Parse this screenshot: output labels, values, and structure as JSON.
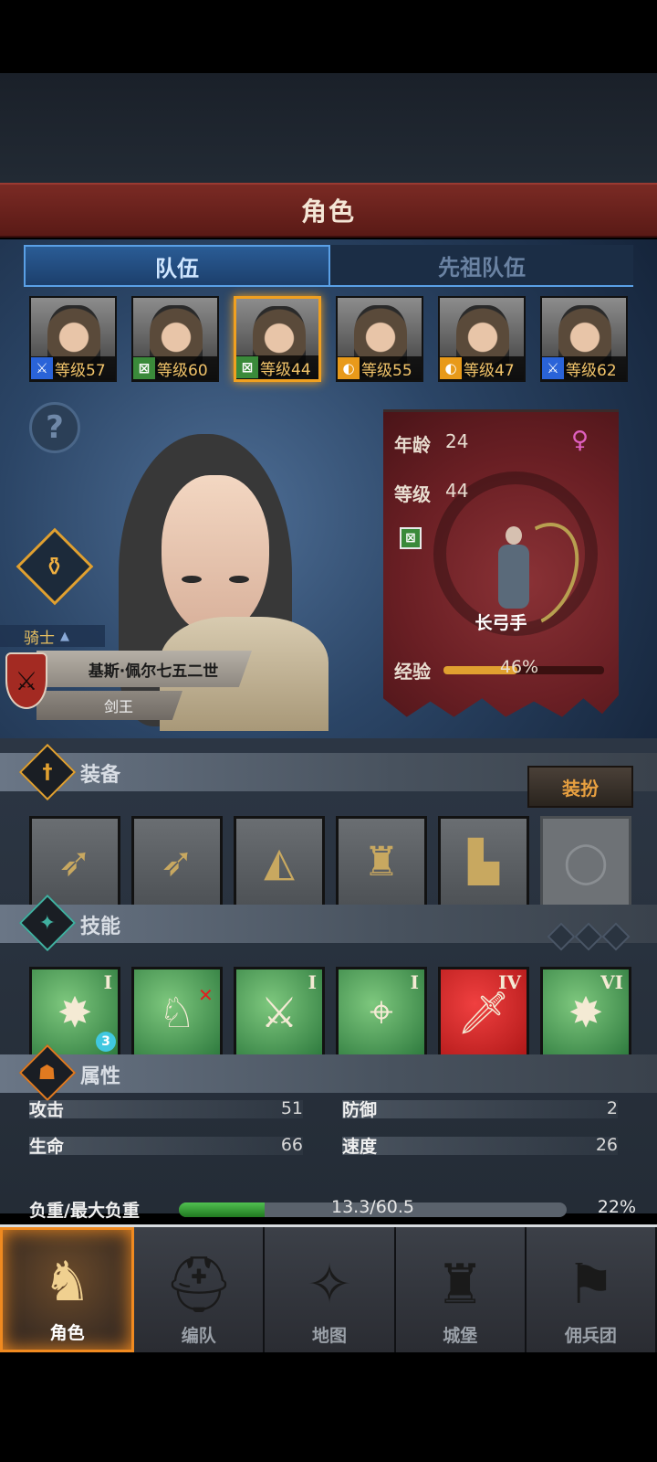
{
  "header": {
    "title": "角色"
  },
  "tabs": [
    {
      "label": "队伍",
      "active": true
    },
    {
      "label": "先祖队伍",
      "active": false
    }
  ],
  "roster": [
    {
      "class_icon": "sword-icon",
      "class_color": "#2a63d8",
      "level_text": "等级57",
      "selected": false
    },
    {
      "class_icon": "bow-icon",
      "class_color": "#3a8a3a",
      "level_text": "等级60",
      "selected": false
    },
    {
      "class_icon": "bow-icon",
      "class_color": "#3a8a3a",
      "level_text": "等级44",
      "selected": true
    },
    {
      "class_icon": "shield-icon",
      "class_color": "#e89a1a",
      "level_text": "等级55",
      "selected": false
    },
    {
      "class_icon": "shield-icon",
      "class_color": "#e89a1a",
      "level_text": "等级47",
      "selected": false
    },
    {
      "class_icon": "sword-icon",
      "class_color": "#2a63d8",
      "level_text": "等级62",
      "selected": false
    }
  ],
  "hero": {
    "rank": "骑士",
    "name": "基斯·佩尔七五二世",
    "title": "剑王"
  },
  "info": {
    "age_label": "年龄",
    "age": "24",
    "level_label": "等级",
    "level": "44",
    "gender": "female",
    "class_name": "长弓手",
    "exp_label": "经验",
    "exp_percent": "46%",
    "exp_fraction": 0.46
  },
  "equipment": {
    "title": "装备",
    "dress_button": "装扮",
    "slots": [
      {
        "icon": "longbow-icon"
      },
      {
        "icon": "longbow-icon"
      },
      {
        "icon": "hood-icon"
      },
      {
        "icon": "leather-armor-icon"
      },
      {
        "icon": "boots-icon"
      },
      {
        "icon": "ring-icon",
        "empty": true
      }
    ]
  },
  "skills": {
    "title": "技能",
    "items": [
      {
        "icon": "burst-sword-icon",
        "rank": "I",
        "badge": "3",
        "color": "green"
      },
      {
        "icon": "crippled-beast-icon",
        "rank": "",
        "color": "green"
      },
      {
        "icon": "bow-sword-icon",
        "rank": "I",
        "color": "green"
      },
      {
        "icon": "crosshair-icon",
        "rank": "I",
        "color": "green"
      },
      {
        "icon": "sword-icon",
        "rank": "IV",
        "color": "red"
      },
      {
        "icon": "burst-icon",
        "rank": "VI",
        "color": "green"
      }
    ]
  },
  "attributes": {
    "title": "属性",
    "attack_label": "攻击",
    "attack": "51",
    "defense_label": "防御",
    "defense": "2",
    "hp_label": "生命",
    "hp": "66",
    "speed_label": "速度",
    "speed": "26",
    "load_label": "负重/最大负重",
    "load_text": "13.3/60.5",
    "load_percent": "22%",
    "load_fraction": 0.22
  },
  "nav": [
    {
      "label": "角色",
      "icon": "knight-icon",
      "active": true
    },
    {
      "label": "编队",
      "icon": "helmet-icon",
      "active": false
    },
    {
      "label": "地图",
      "icon": "compass-icon",
      "active": false
    },
    {
      "label": "城堡",
      "icon": "castle-icon",
      "active": false
    },
    {
      "label": "佣兵团",
      "icon": "mercenary-icon",
      "active": false
    }
  ]
}
